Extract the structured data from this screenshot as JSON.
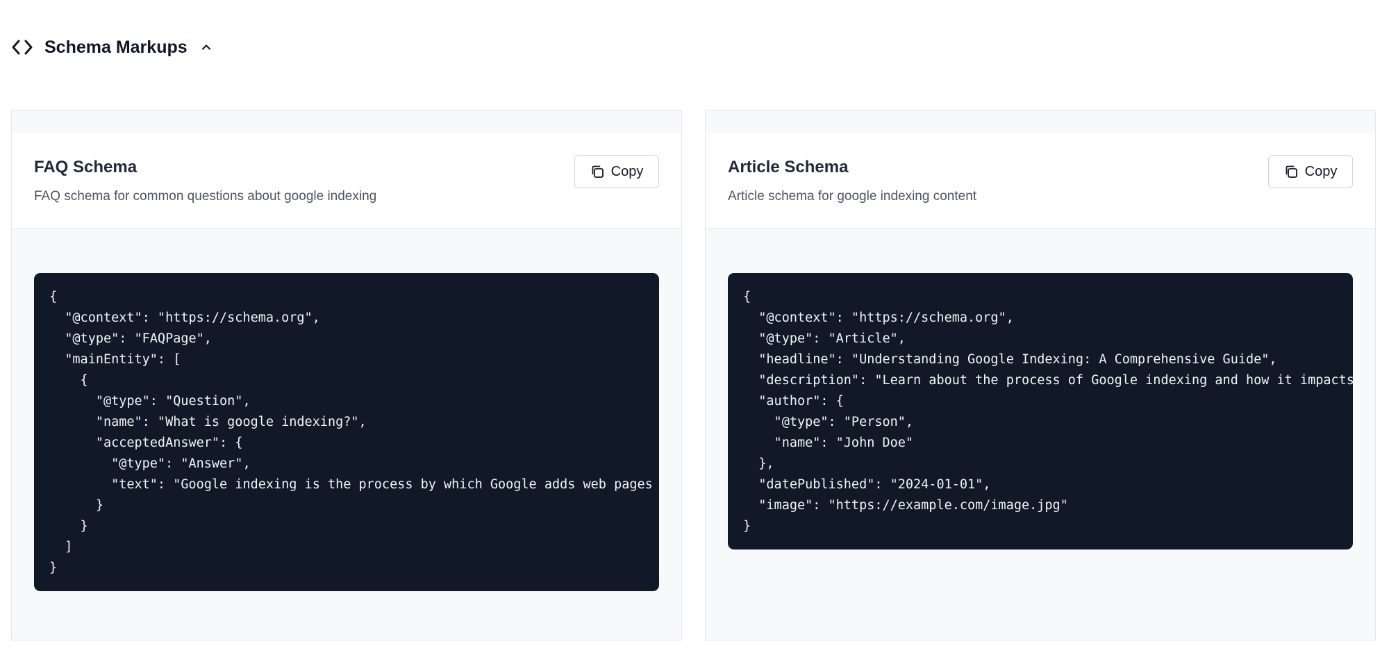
{
  "section": {
    "title": "Schema Markups",
    "code_icon": "code-icon",
    "toggle_icon": "chevron-up-icon"
  },
  "cards": [
    {
      "title": "FAQ Schema",
      "description": "FAQ schema for common questions about google indexing",
      "copy_label": "Copy",
      "copy_icon": "copy-icon",
      "code": "{\n  \"@context\": \"https://schema.org\",\n  \"@type\": \"FAQPage\",\n  \"mainEntity\": [\n    {\n      \"@type\": \"Question\",\n      \"name\": \"What is google indexing?\",\n      \"acceptedAnswer\": {\n        \"@type\": \"Answer\",\n        \"text\": \"Google indexing is the process by which Google adds web pages\n      }\n    }\n  ]\n}"
    },
    {
      "title": "Article Schema",
      "description": "Article schema for google indexing content",
      "copy_label": "Copy",
      "copy_icon": "copy-icon",
      "code": "{\n  \"@context\": \"https://schema.org\",\n  \"@type\": \"Article\",\n  \"headline\": \"Understanding Google Indexing: A Comprehensive Guide\",\n  \"description\": \"Learn about the process of Google indexing and how it impacts\n  \"author\": {\n    \"@type\": \"Person\",\n    \"name\": \"John Doe\"\n  },\n  \"datePublished\": \"2024-01-01\",\n  \"image\": \"https://example.com/image.jpg\"\n}"
    }
  ],
  "colors": {
    "code_bg": "#111827",
    "card_bg": "#f8f9fb",
    "border": "#e5e7eb"
  }
}
